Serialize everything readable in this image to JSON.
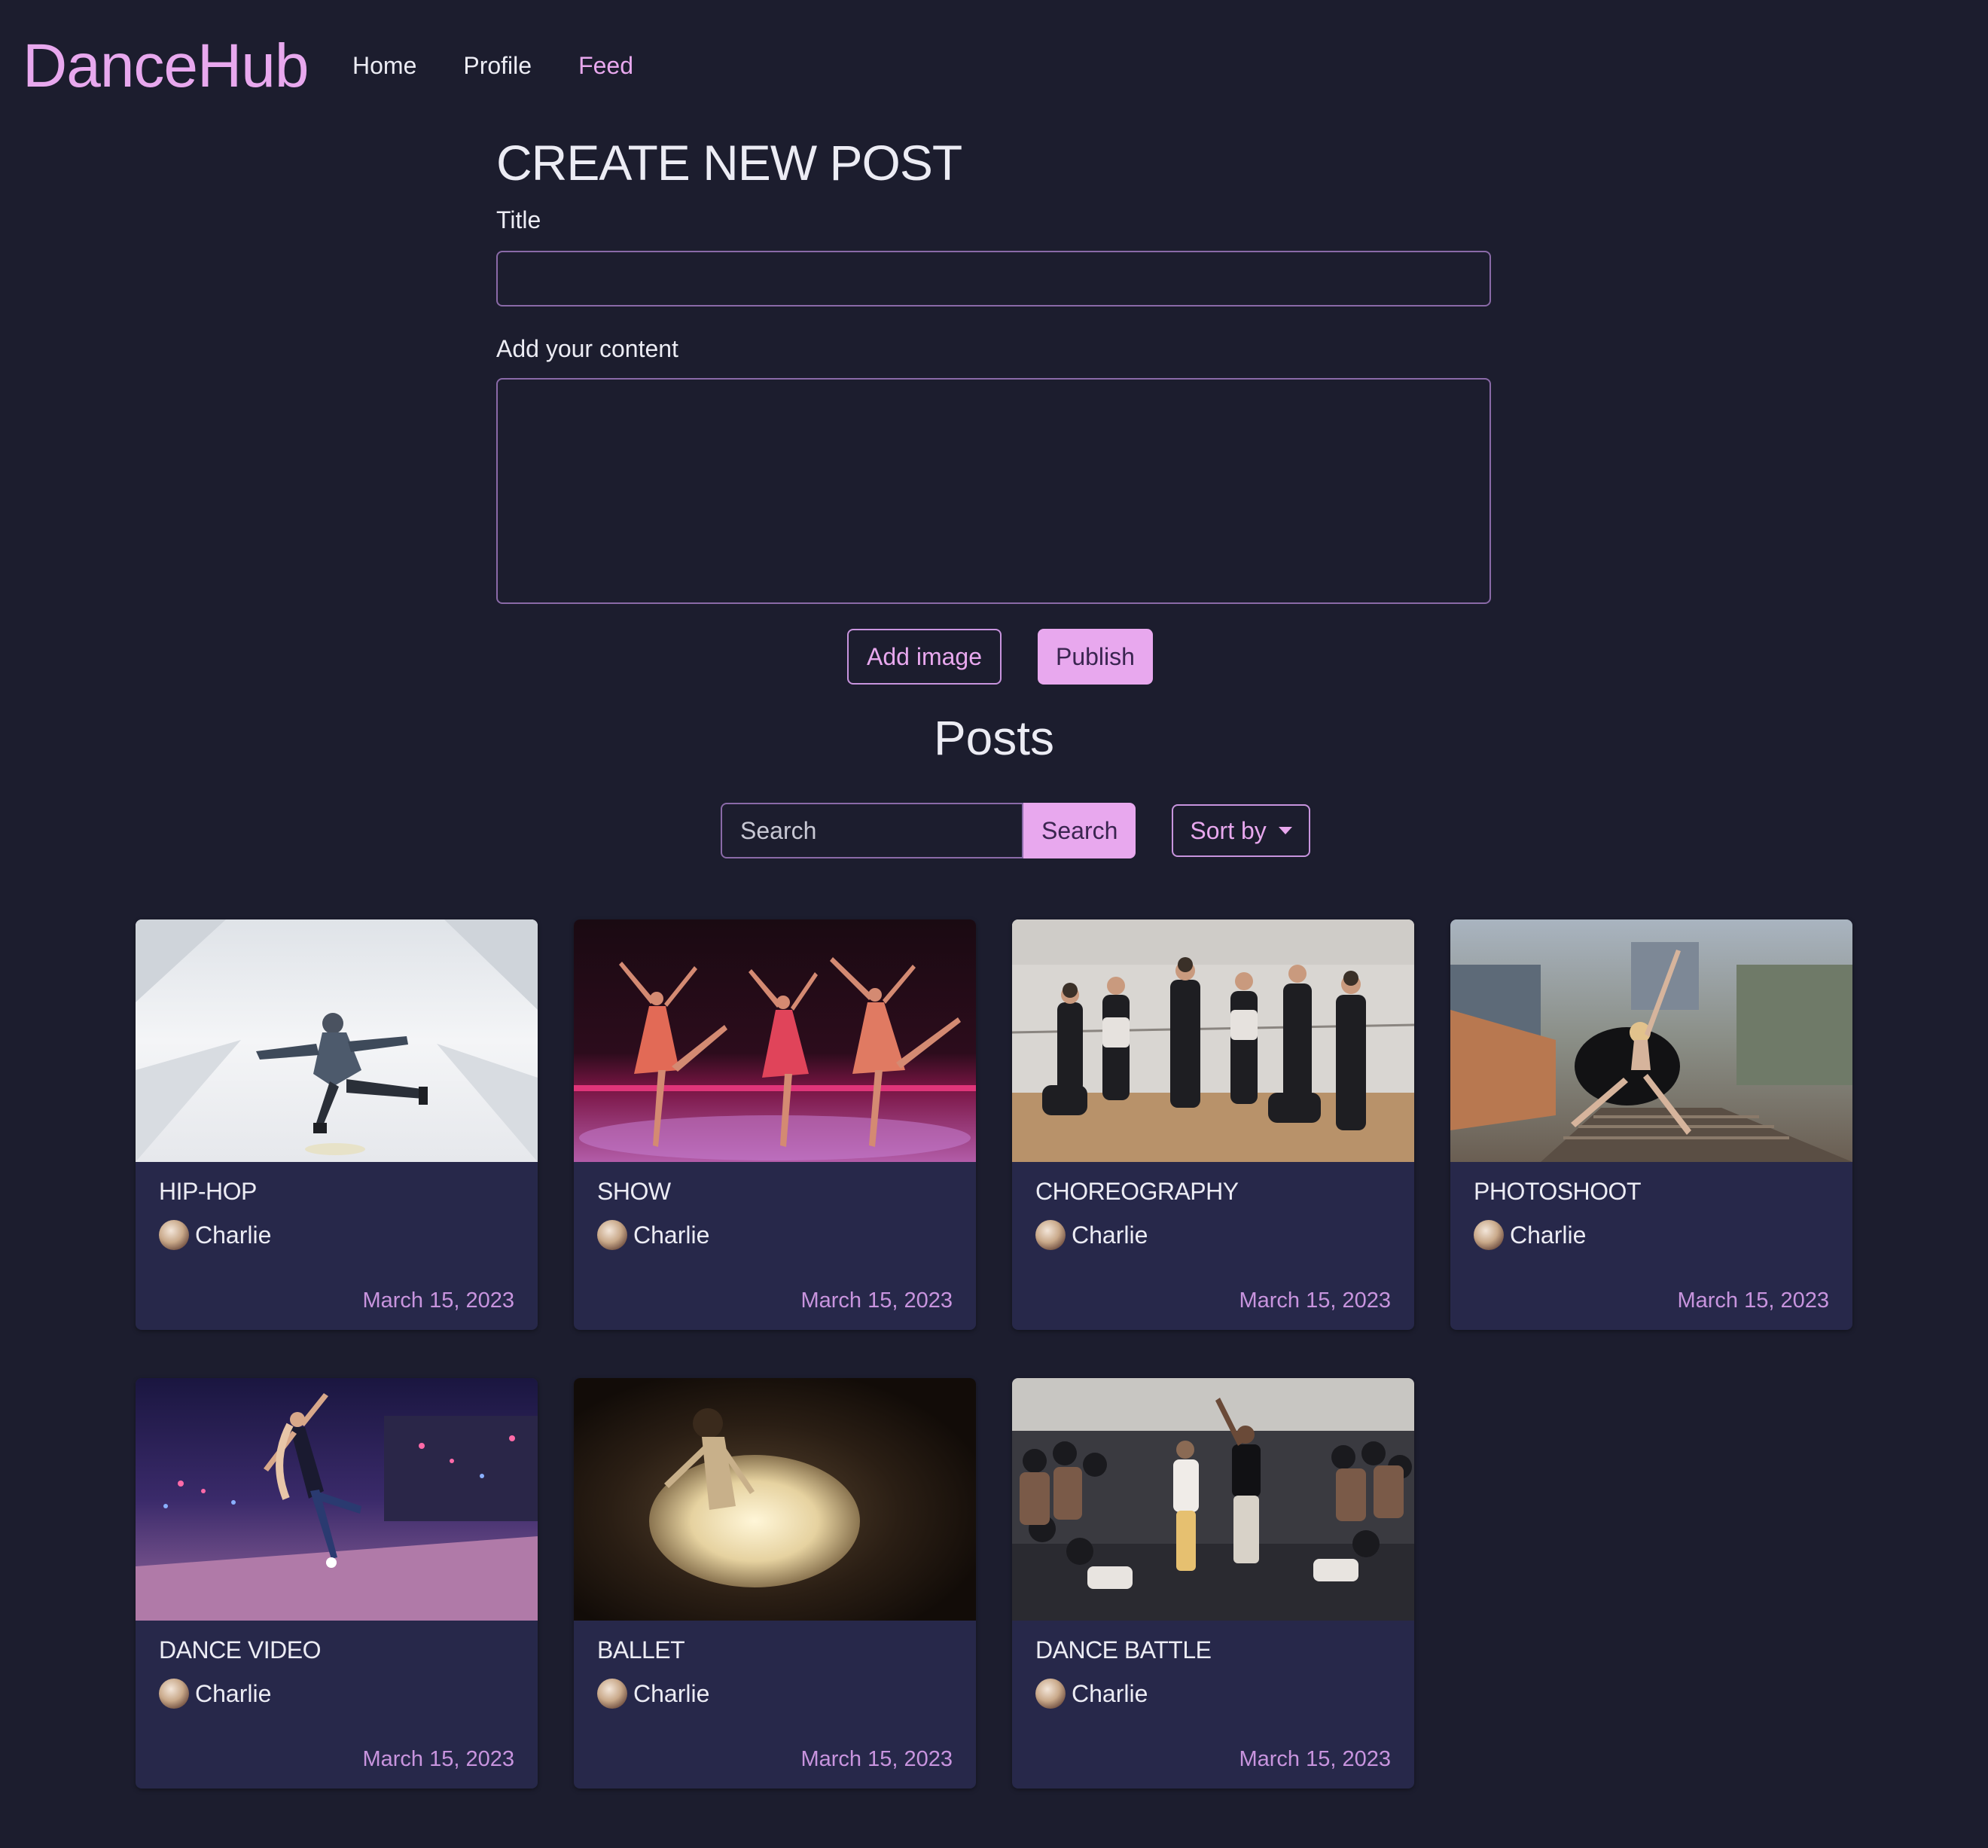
{
  "nav": {
    "brand": "DanceHub",
    "links": [
      {
        "label": "Home",
        "active": false
      },
      {
        "label": "Profile",
        "active": false
      },
      {
        "label": "Feed",
        "active": true
      }
    ]
  },
  "create_post": {
    "heading": "CREATE NEW POST",
    "title_label": "Title",
    "title_value": "",
    "content_label": "Add your content",
    "content_value": "",
    "add_image_label": "Add image",
    "publish_label": "Publish"
  },
  "posts": {
    "heading": "Posts",
    "search_placeholder": "Search",
    "search_button": "Search",
    "sort_label": "Sort by",
    "items": [
      {
        "title": "HIP-HOP",
        "author": "Charlie",
        "date": "March 15, 2023"
      },
      {
        "title": "SHOW",
        "author": "Charlie",
        "date": "March 15, 2023"
      },
      {
        "title": "CHOREOGRAPHY",
        "author": "Charlie",
        "date": "March 15, 2023"
      },
      {
        "title": "PHOTOSHOOT",
        "author": "Charlie",
        "date": "March 15, 2023"
      },
      {
        "title": "DANCE VIDEO",
        "author": "Charlie",
        "date": "March 15, 2023"
      },
      {
        "title": "BALLET",
        "author": "Charlie",
        "date": "March 15, 2023"
      },
      {
        "title": "DANCE BATTLE",
        "author": "Charlie",
        "date": "March 15, 2023"
      }
    ]
  },
  "colors": {
    "background": "#1c1d2e",
    "card": "#27284a",
    "accent": "#e8a8ee",
    "accent_text": "#c894de"
  }
}
